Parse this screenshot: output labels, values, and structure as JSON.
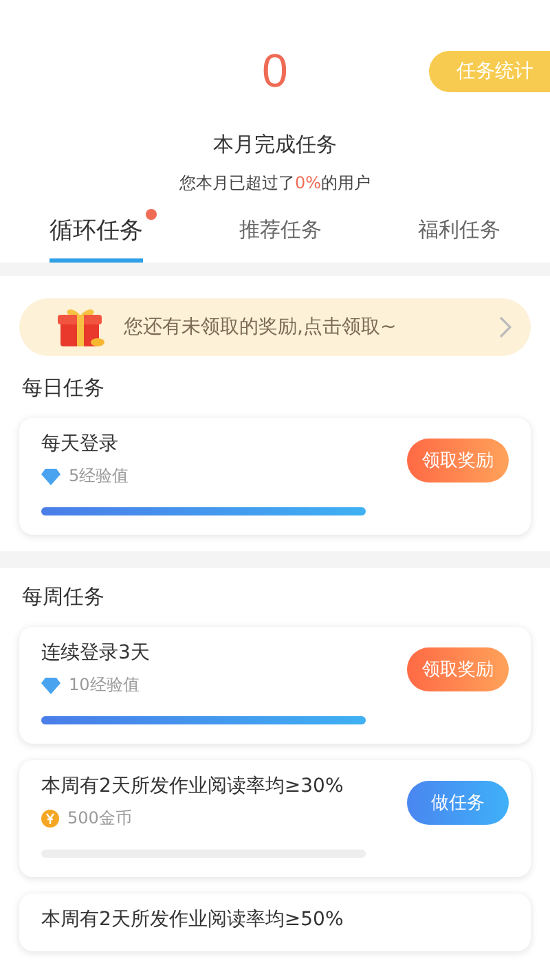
{
  "header": {
    "count": "0",
    "stats_button": "任务统计",
    "caption": "本月完成任务",
    "summary": "您本月已超过了**0%**的用户"
  },
  "tabs": [
    {
      "label": "循环任务",
      "selected": true,
      "badge": true
    },
    {
      "label": "推荐任务",
      "selected": false,
      "badge": false
    },
    {
      "label": "福利任务",
      "selected": false,
      "badge": false
    }
  ],
  "reward_banner": {
    "text": "您还有未领取的奖励,点击领取~"
  },
  "sections": [
    {
      "title": "每日任务",
      "tasks": [
        {
          "title": "每天登录",
          "reward": {
            "kind": "exp",
            "text": "5经验值"
          },
          "level": 1,
          "action": {
            "kind": "claim",
            "label": "领取奖励"
          }
        }
      ]
    },
    {
      "title": "每周任务",
      "tasks": [
        {
          "title": "连续登录3天",
          "reward": {
            "kind": "exp",
            "text": "10经验值"
          },
          "level": 1,
          "action": {
            "kind": "claim",
            "label": "领取奖励"
          }
        },
        {
          "title": "本周有2天所发作业阅读率均≥30%",
          "reward": {
            "kind": "coin",
            "text": "500金币"
          },
          "level": 0,
          "action": {
            "kind": "do",
            "label": "做任务"
          }
        },
        {
          "title": "本周有2天所发作业阅读率均≥50%"
        }
      ]
    }
  ]
}
